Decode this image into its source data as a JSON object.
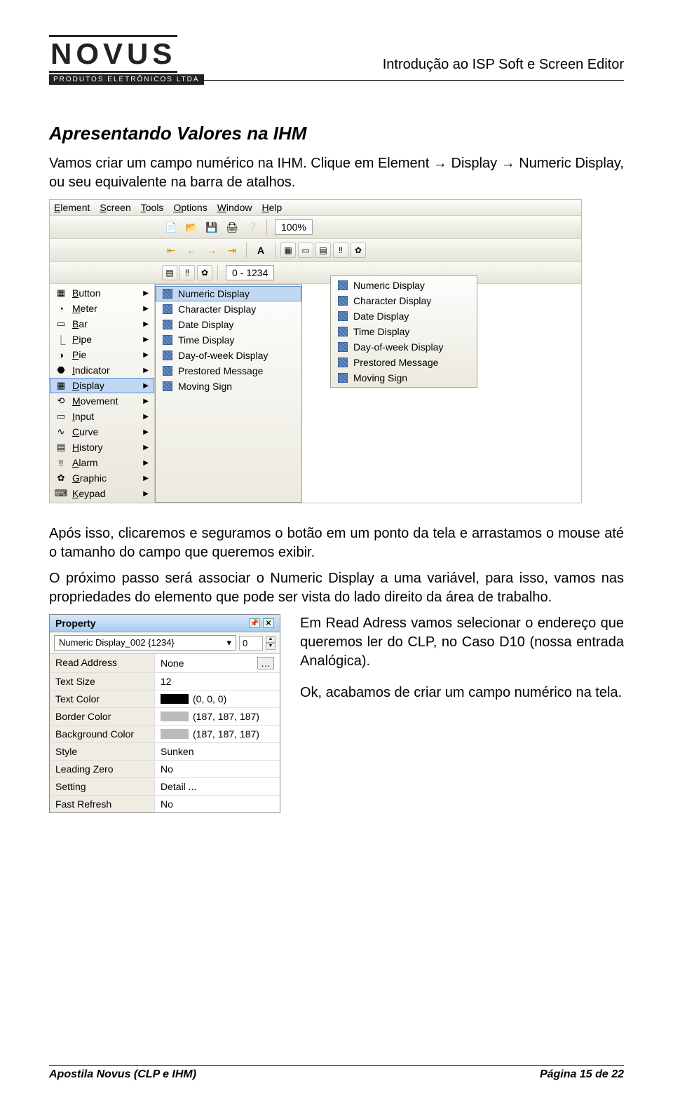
{
  "logo": {
    "brand": "NOVUS",
    "tagline": "PRODUTOS ELETRÔNICOS LTDA"
  },
  "doc_title": "Introdução ao ISP Soft e Screen Editor",
  "heading": "Apresentando Valores na IHM",
  "para1a": "Vamos criar um campo numérico na IHM. Clique em Element ",
  "para1b": " Display ",
  "para1c": " Numeric Display, ou seu equivalente na barra de atalhos.",
  "para2": "Após isso, clicaremos e seguramos o botão em um ponto da tela e arrastamos o mouse até o tamanho do campo que queremos exibir.",
  "para3": "O próximo passo será associar o Numeric Display a uma variável, para isso, vamos nas propriedades do elemento que pode ser vista do lado direito da área de trabalho.",
  "para4": "Em Read Adress vamos selecionar o endereço que queremos ler do CLP, no Caso D10 (nossa entrada Analógica).",
  "para5": "Ok, acabamos de criar um campo numérico na tela.",
  "menubar": [
    "Element",
    "Screen",
    "Tools",
    "Options",
    "Window",
    "Help"
  ],
  "zoom": "100%",
  "range_box": "0 - 1234",
  "element_menu": [
    {
      "icon": "▦",
      "label": "Button"
    },
    {
      "icon": "◔",
      "label": "Meter"
    },
    {
      "icon": "▭",
      "label": "Bar"
    },
    {
      "icon": "⎿",
      "label": "Pipe"
    },
    {
      "icon": "◑",
      "label": "Pie"
    },
    {
      "icon": "⬣",
      "label": "Indicator"
    },
    {
      "icon": "▦",
      "label": "Display",
      "hover": true
    },
    {
      "icon": "⟲",
      "label": "Movement"
    },
    {
      "icon": "▭",
      "label": "Input"
    },
    {
      "icon": "∿",
      "label": "Curve"
    },
    {
      "icon": "▤",
      "label": "History"
    },
    {
      "icon": "‼",
      "label": "Alarm"
    },
    {
      "icon": "✿",
      "label": "Graphic"
    },
    {
      "icon": "⌨",
      "label": "Keypad"
    }
  ],
  "display_submenu": [
    {
      "label": "Numeric Display",
      "hover": true
    },
    {
      "label": "Character Display"
    },
    {
      "label": "Date Display"
    },
    {
      "label": "Time Display"
    },
    {
      "label": "Day-of-week Display"
    },
    {
      "label": "Prestored Message"
    },
    {
      "label": "Moving Sign"
    }
  ],
  "display_submenu2": [
    {
      "label": "Numeric Display"
    },
    {
      "label": "Character Display"
    },
    {
      "label": "Date Display"
    },
    {
      "label": "Time Display"
    },
    {
      "label": "Day-of-week Display"
    },
    {
      "label": "Prestored Message"
    },
    {
      "label": "Moving Sign"
    }
  ],
  "property": {
    "title": "Property",
    "object": "Numeric Display_002 {1234}",
    "objnum": "0",
    "rows": [
      {
        "label": "Read Address",
        "value": "None",
        "ellipsis": true
      },
      {
        "label": "Text Size",
        "value": "12"
      },
      {
        "label": "Text Color",
        "value": "(0, 0, 0)",
        "swatch": "#000000"
      },
      {
        "label": "Border Color",
        "value": "(187, 187, 187)",
        "swatch": "#bbbbbb"
      },
      {
        "label": "Background Color",
        "value": "(187, 187, 187)",
        "swatch": "#bbbbbb"
      },
      {
        "label": "Style",
        "value": "Sunken"
      },
      {
        "label": "Leading Zero",
        "value": "No"
      },
      {
        "label": "Setting",
        "value": "Detail ..."
      },
      {
        "label": "Fast Refresh",
        "value": "No"
      }
    ]
  },
  "footer": {
    "left": "Apostila Novus (CLP e IHM)",
    "right": "Página 15 de 22"
  }
}
